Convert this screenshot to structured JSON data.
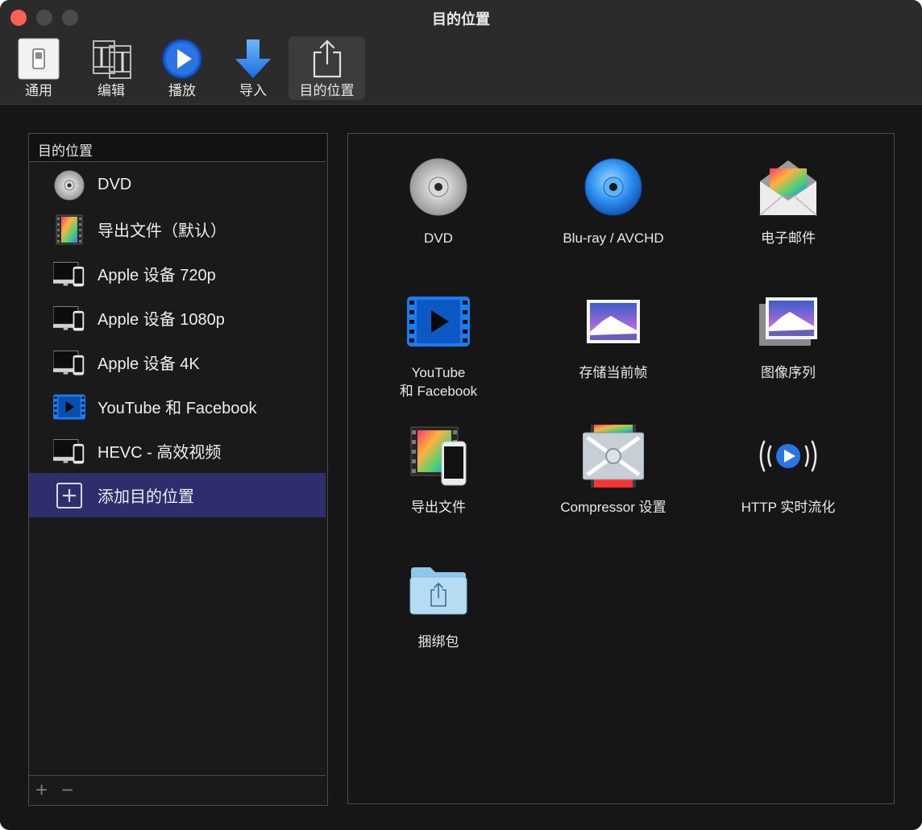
{
  "window": {
    "title": "目的位置"
  },
  "toolbar": {
    "general": "通用",
    "edit": "编辑",
    "playback": "播放",
    "import": "导入",
    "destinations": "目的位置"
  },
  "sidebar": {
    "header": "目的位置",
    "items": [
      {
        "label": "DVD",
        "icon": "dvd-disc-icon"
      },
      {
        "label": "导出文件（默认）",
        "icon": "film-frame-icon"
      },
      {
        "label": "Apple 设备 720p",
        "icon": "apple-devices-icon"
      },
      {
        "label": "Apple 设备 1080p",
        "icon": "apple-devices-icon"
      },
      {
        "label": "Apple 设备 4K",
        "icon": "apple-devices-icon"
      },
      {
        "label": "YouTube 和 Facebook",
        "icon": "video-play-icon"
      },
      {
        "label": "HEVC - 高效视频",
        "icon": "apple-devices-icon"
      },
      {
        "label": "添加目的位置",
        "icon": "add-box-icon"
      }
    ],
    "footer": {
      "add": "+",
      "remove": "−"
    }
  },
  "destinations": [
    {
      "label": "DVD",
      "icon": "dvd-disc-icon"
    },
    {
      "label": "Blu-ray / AVCHD",
      "icon": "bluray-disc-icon"
    },
    {
      "label": "电子邮件",
      "icon": "email-envelope-icon"
    },
    {
      "label": "YouTube\n和 Facebook",
      "icon": "video-play-icon"
    },
    {
      "label": "存储当前帧",
      "icon": "photo-icon"
    },
    {
      "label": "图像序列",
      "icon": "photo-stack-icon"
    },
    {
      "label": "导出文件",
      "icon": "film-phone-icon"
    },
    {
      "label": "Compressor 设置",
      "icon": "compressor-icon"
    },
    {
      "label": "HTTP 实时流化",
      "icon": "http-streaming-icon"
    },
    {
      "label": "捆绑包",
      "icon": "bundle-folder-icon"
    }
  ],
  "colors": {
    "window_bg": "#161616",
    "toolbar_bg": "#2b2b2b",
    "selection": "#2d2e6b",
    "accent_blue": "#1f6fd6"
  }
}
